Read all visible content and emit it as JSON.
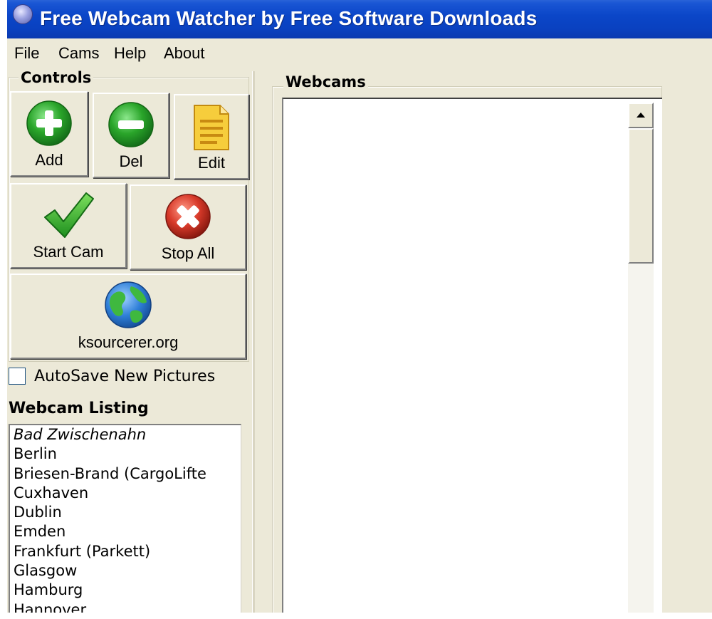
{
  "window": {
    "title": "Free Webcam Watcher by Free Software Downloads"
  },
  "menu": {
    "items": [
      "File",
      "Cams",
      "Help",
      "About"
    ]
  },
  "controls": {
    "title": "Controls",
    "add_label": "Add",
    "del_label": "Del",
    "edit_label": "Edit",
    "start_label": "Start Cam",
    "stop_label": "Stop All",
    "link_label": "ksourcerer.org"
  },
  "autosave": {
    "label": "AutoSave New Pictures",
    "checked": false
  },
  "listing": {
    "title": "Webcam Listing",
    "items": [
      "Bad Zwischenahn",
      "Berlin",
      "Briesen-Brand (CargoLifte",
      "Cuxhaven",
      "Dublin",
      "Emden",
      "Frankfurt (Parkett)",
      "Glasgow",
      "Hamburg",
      "Hannover"
    ]
  },
  "webcams": {
    "title": "Webcams"
  },
  "icons": {
    "add": "plus-circle-icon",
    "del": "minus-circle-icon",
    "edit": "document-icon",
    "start": "checkmark-icon",
    "stop": "x-circle-icon",
    "link": "globe-icon",
    "scroll_up": "arrow-up-icon"
  },
  "colors": {
    "titlebar": "#0a46c8",
    "face": "#ece9d8",
    "add_green": "#2aa52a",
    "stop_red": "#d83a2a",
    "edit_yellow": "#f2c531",
    "globe_blue": "#2f7fd8"
  }
}
